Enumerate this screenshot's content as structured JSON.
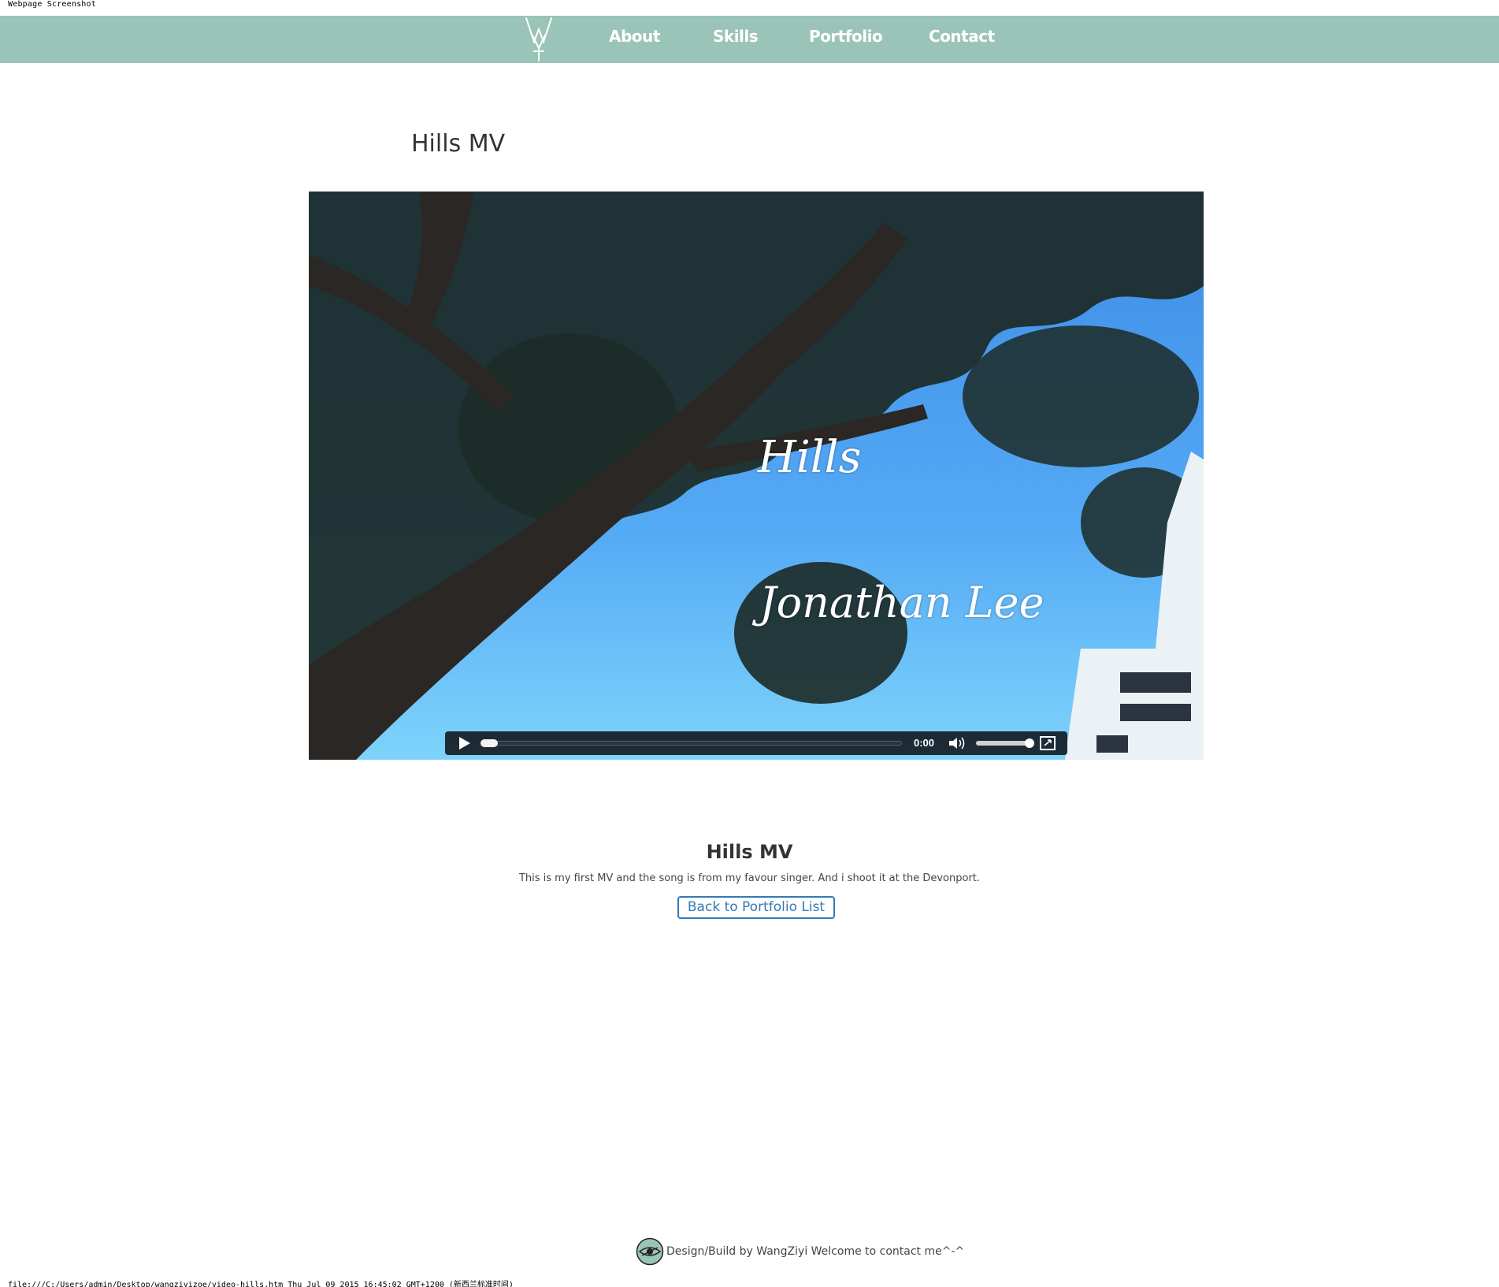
{
  "print": {
    "header": "Webpage Screenshot",
    "footer": "file:///C:/Users/admin/Desktop/wangziyizoe/video-hills.htm Thu Jul 09 2015 16:45:02 GMT+1200 (新西兰标准时间)"
  },
  "nav": {
    "logo_icon": "wy-monogram-logo",
    "items": [
      {
        "label": "About"
      },
      {
        "label": "Skills"
      },
      {
        "label": "Portfolio"
      },
      {
        "label": "Contact"
      }
    ],
    "background": "#9bc4b8"
  },
  "page": {
    "title": "Hills MV"
  },
  "video": {
    "overlay_title": "Hills",
    "overlay_artist": "Jonathan Lee",
    "controls": {
      "play_icon": "play-icon",
      "time": "0:00",
      "progress": 0,
      "volume_icon": "volume-icon",
      "volume_level": 1.0,
      "fullscreen_icon": "fullscreen-icon"
    }
  },
  "details": {
    "title": "Hills MV",
    "description": "This is my first MV and the song is from my favour singer. And i shoot it at the Devonport.",
    "back_button": "Back to Portfolio List",
    "accent": "#337ab7"
  },
  "footer": {
    "logo_icon": "eye-logo-icon",
    "text": "Design/Build by WangZiyi Welcome to contact me^-^"
  }
}
